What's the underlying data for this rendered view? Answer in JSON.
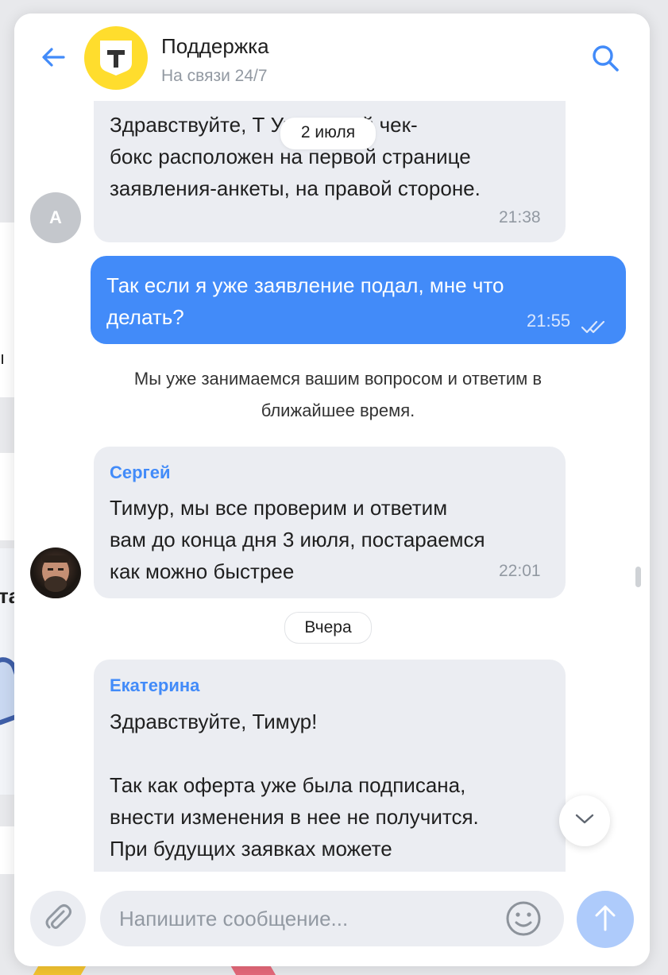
{
  "colors": {
    "accent": "#428bf9",
    "brand_yellow": "#ffdd2d",
    "incoming_bubble": "#ebedf2",
    "muted_text": "#9299a2"
  },
  "header": {
    "title": "Поддержка",
    "subtitle": "На связи 24/7",
    "back_icon": "arrow-left-icon",
    "search_icon": "search-icon",
    "logo_letter": "Т"
  },
  "date_chips": {
    "top": "2 июля",
    "middle": "Вчера"
  },
  "messages": [
    {
      "direction": "in",
      "avatar_letter": "A",
      "text": "Здравствуйте, Т          Указанный чек-\nбокс расположен на первой странице\nзаявления-анкеты, на правой стороне.",
      "time": "21:38"
    },
    {
      "direction": "out",
      "text": "Так если я уже заявление подал, мне что\nделать?",
      "time": "21:55",
      "status_icon": "double-check-icon"
    },
    {
      "direction": "system",
      "text": "Мы уже занимаемся вашим вопросом и ответим в\nближайшее время."
    },
    {
      "direction": "in",
      "sender": "Сергей",
      "text": "Тимур, мы все проверим и ответим\nвам до конца дня 3 июля, постараемся\nкак можно быстрее",
      "time": "22:01"
    },
    {
      "direction": "in",
      "sender": "Екатерина",
      "text": "Здравствуйте, Тимур!\n\nТак как оферта уже была подписана,\nвнести изменения в нее не получится.\nПри будущих заявках можете"
    }
  ],
  "composer": {
    "placeholder": "Напишите сообщение...",
    "attach_icon": "paperclip-icon",
    "emoji_icon": "smiley-icon",
    "send_icon": "arrow-up-icon"
  },
  "scroll_down_icon": "chevron-down-icon",
  "background": {
    "glyph_1": "ı",
    "glyph_2": "та"
  }
}
